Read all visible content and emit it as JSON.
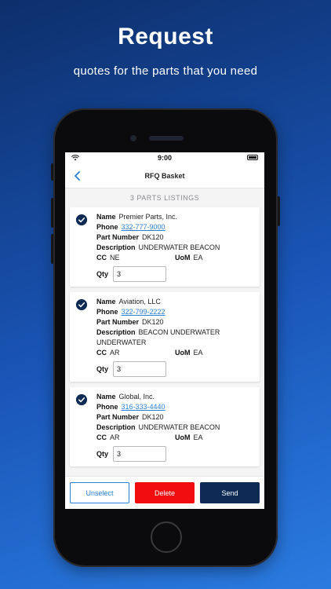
{
  "promo": {
    "headline": "Request",
    "subline": "quotes for the parts that you need"
  },
  "status_bar": {
    "time": "9:00"
  },
  "nav": {
    "title": "RFQ Basket",
    "back_icon": "chevron-left-icon"
  },
  "listing_count": "3 PARTS LISTINGS",
  "field_labels": {
    "name": "Name",
    "phone": "Phone",
    "part_number": "Part Number",
    "description": "Description",
    "cc": "CC",
    "uom": "UoM",
    "qty": "Qty"
  },
  "listings": [
    {
      "name": "Premier Parts, Inc.",
      "phone": "332-777-9000",
      "part_number": "DK120",
      "description": "UNDERWATER BEACON",
      "cc": "NE",
      "uom": "EA",
      "qty": "3"
    },
    {
      "name": "Aviation, LLC",
      "phone": "322-799-2222",
      "part_number": "DK120",
      "description": "BEACON UNDERWATER UNDERWATER",
      "cc": "AR",
      "uom": "EA",
      "qty": "3"
    },
    {
      "name": "Global, Inc.",
      "phone": "316-333-4440",
      "part_number": "DK120",
      "description": "UNDERWATER BEACON",
      "cc": "AR",
      "uom": "EA",
      "qty": "3"
    }
  ],
  "actions": {
    "unselect": "Unselect",
    "delete": "Delete",
    "send": "Send"
  },
  "colors": {
    "accent_navy": "#0d2b55",
    "link_blue": "#2a7fd6",
    "delete_red": "#f20e0e"
  }
}
